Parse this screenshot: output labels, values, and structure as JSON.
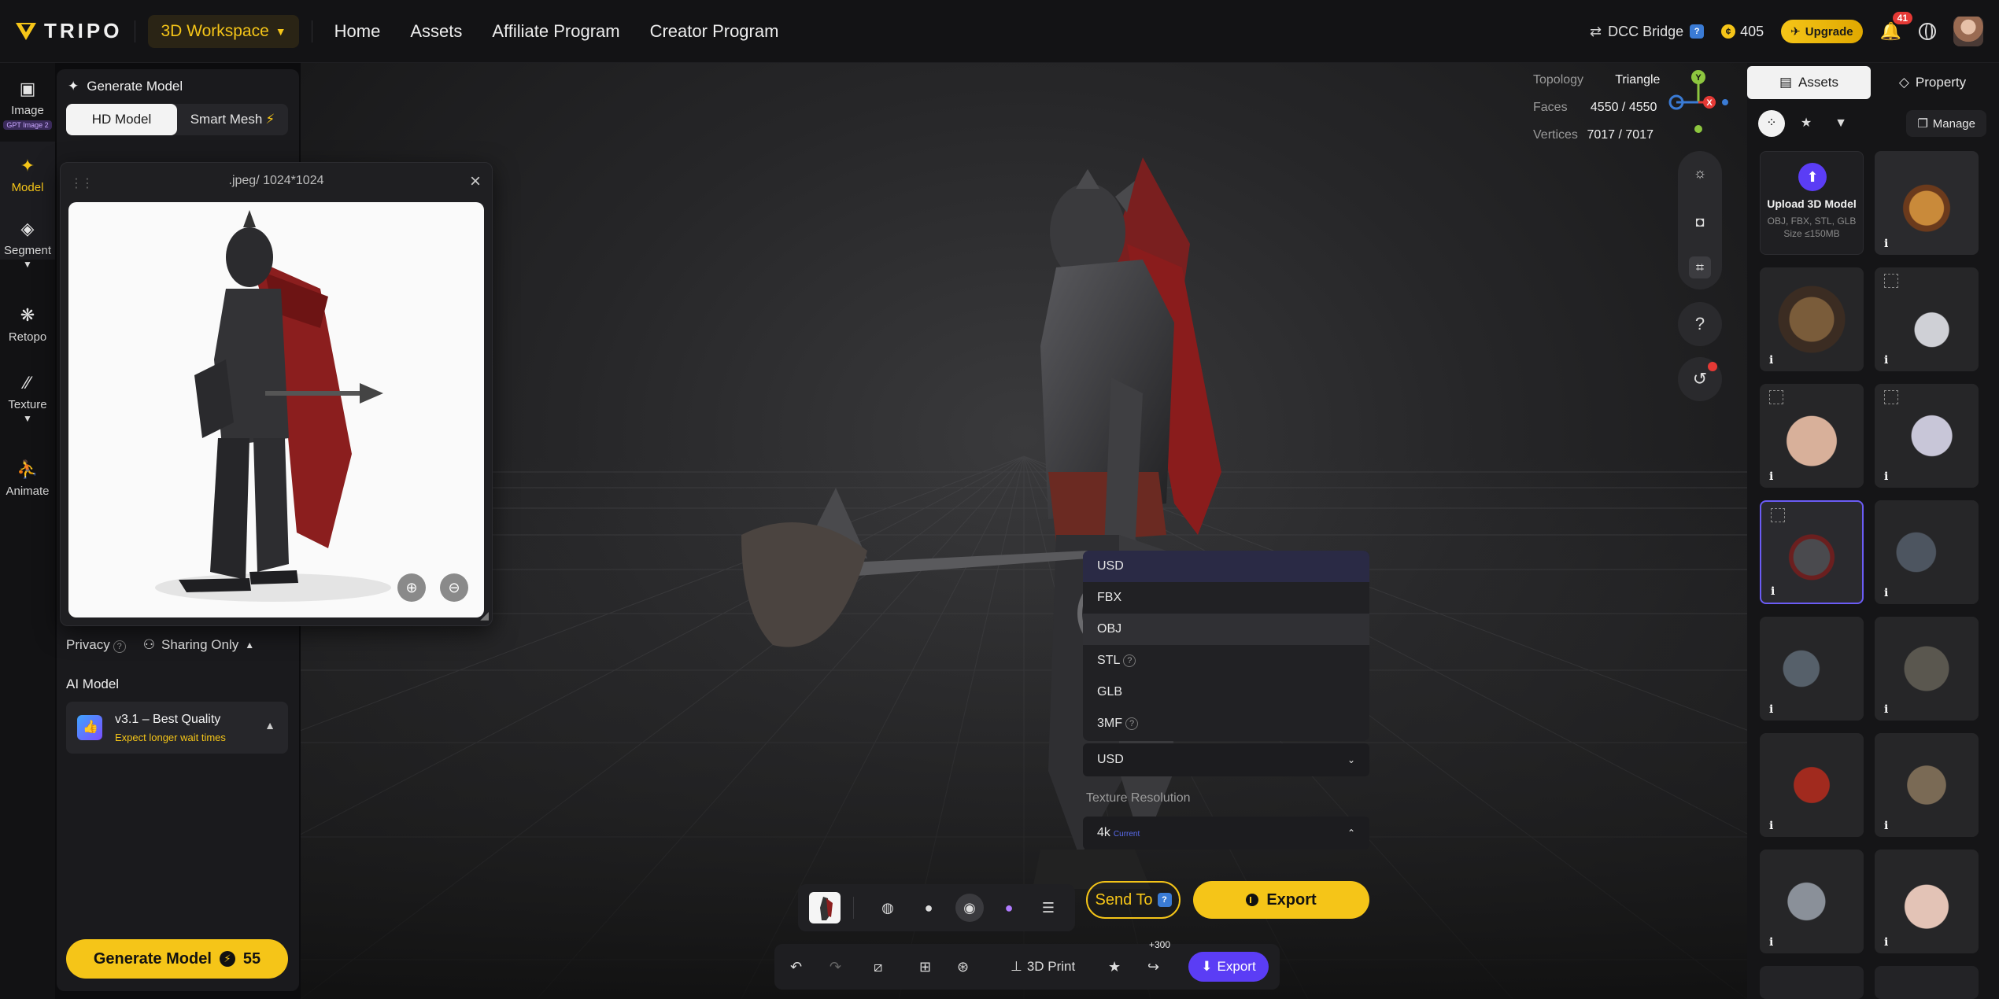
{
  "app": {
    "brand": "TRIPO"
  },
  "topbar": {
    "workspace": "3D Workspace",
    "nav": [
      "Home",
      "Assets",
      "Affiliate Program",
      "Creator Program"
    ],
    "dcc_bridge": "DCC Bridge",
    "credits": "405",
    "upgrade": "Upgrade",
    "notifications": "41"
  },
  "rail": {
    "items": [
      {
        "label": "Image",
        "badge": "GPT Image 2",
        "icon": "image-icon"
      },
      {
        "label": "Model",
        "icon": "sparkle-icon"
      },
      {
        "label": "Segment",
        "icon": "cube-icon"
      },
      {
        "label": "Retopo",
        "icon": "mesh-icon"
      },
      {
        "label": "Texture",
        "icon": "texture-icon"
      },
      {
        "label": "Animate",
        "icon": "figure-icon"
      }
    ]
  },
  "left_panel": {
    "title": "Generate Model",
    "mode_hd": "HD Model",
    "mode_smart": "Smart Mesh",
    "privacy": "Privacy",
    "sharing": "Sharing Only",
    "ai_model_label": "AI Model",
    "ai_model_name": "v3.1 – Best Quality",
    "ai_model_note": "Expect longer wait times",
    "generate": "Generate Model",
    "generate_cost": "55"
  },
  "popup": {
    "title": ".jpeg/ 1024*1024"
  },
  "viewport": {
    "stats": {
      "topology_label": "Topology",
      "topology": "Triangle",
      "faces_label": "Faces",
      "faces": "4550 / 4550",
      "vertices_label": "Vertices",
      "vertices": "7017 / 7017"
    },
    "gizmo": {
      "y": "Y",
      "x": "X"
    }
  },
  "export_menu": {
    "formats": [
      "USD",
      "FBX",
      "OBJ",
      "STL",
      "GLB",
      "3MF"
    ],
    "selected_format": "USD",
    "texture_label": "Texture Resolution",
    "texture_value": "4k",
    "texture_current": "Current",
    "send_to": "Send To",
    "export": "Export"
  },
  "bottom_toolbar": {
    "print": "3D Print",
    "plus": "+300",
    "export": "Export"
  },
  "right_panel": {
    "tab_assets": "Assets",
    "tab_property": "Property",
    "manage": "Manage",
    "upload_title": "Upload 3D Model",
    "upload_formats": "OBJ, FBX, STL, GLB",
    "upload_size": "Size ≤150MB",
    "info": "i"
  },
  "colors": {
    "accent": "#f5c518",
    "purple": "#5b3df5",
    "bg": "#0c0c0e"
  }
}
